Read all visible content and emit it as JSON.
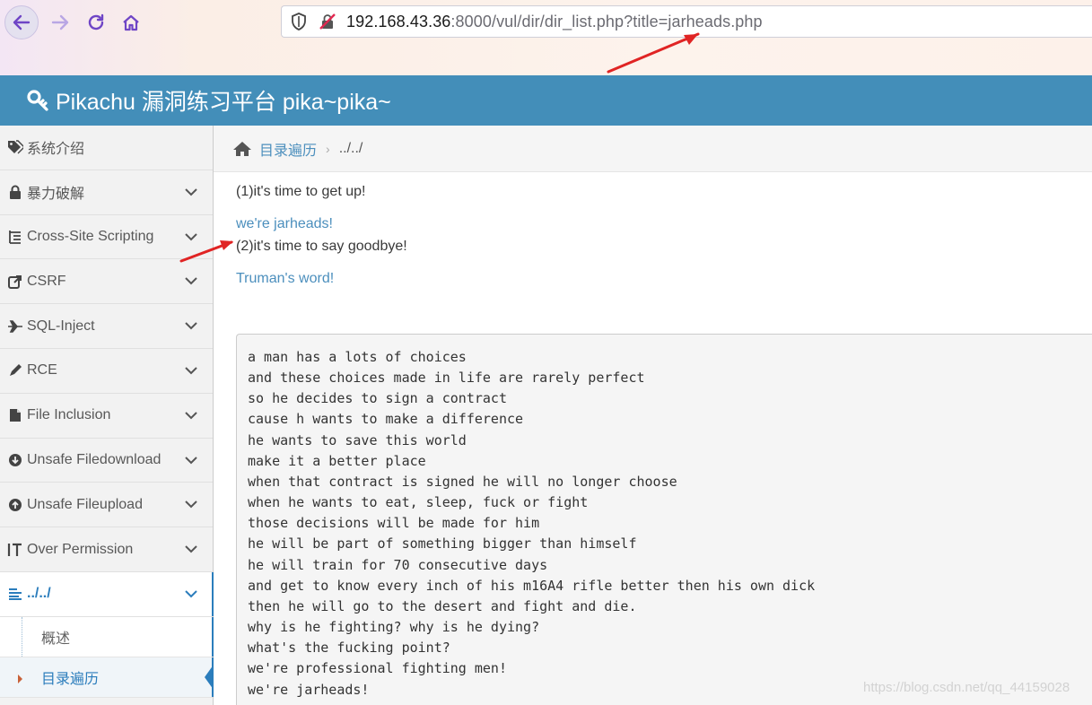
{
  "browser": {
    "url_host": "192.168.43.36",
    "url_rest": ":8000/vul/dir/dir_list.php?title=jarheads.php"
  },
  "header": {
    "title": "Pikachu 漏洞练习平台 pika~pika~"
  },
  "sidebar": {
    "items": [
      {
        "label": "系统介绍",
        "icon": "tags-icon",
        "expandable": false
      },
      {
        "label": "暴力破解",
        "icon": "lock-icon",
        "expandable": true
      },
      {
        "label": "Cross-Site Scripting",
        "icon": "list-tree-icon",
        "expandable": true
      },
      {
        "label": "CSRF",
        "icon": "share-icon",
        "expandable": true
      },
      {
        "label": "SQL-Inject",
        "icon": "plane-icon",
        "expandable": true
      },
      {
        "label": "RCE",
        "icon": "pencil-icon",
        "expandable": true
      },
      {
        "label": "File Inclusion",
        "icon": "file-icon",
        "expandable": true
      },
      {
        "label": "Unsafe Filedownload",
        "icon": "download-circle-icon",
        "expandable": true
      },
      {
        "label": "Unsafe Fileupload",
        "icon": "upload-circle-icon",
        "expandable": true
      },
      {
        "label": "Over Permission",
        "icon": "text-height-icon",
        "expandable": true
      },
      {
        "label": "../../",
        "icon": "align-left-icon",
        "expandable": true
      }
    ],
    "subitems": [
      {
        "label": "概述"
      },
      {
        "label": "目录遍历"
      }
    ]
  },
  "breadcrumb": {
    "home_link": "目录遍历",
    "current": "../../"
  },
  "content": {
    "line1": "(1)it's time to get up!",
    "link1": "we're jarheads!",
    "line2": "(2)it's time to say goodbye!",
    "link2": "Truman's word!"
  },
  "poem": [
    "a man has a lots of choices",
    "and these choices made in life are rarely perfect",
    "so he decides to sign a contract",
    "cause h wants to make a difference",
    "he wants to save this world",
    "make it a better place",
    "when that contract is signed he will no longer choose",
    "when he wants to eat, sleep, fuck or fight",
    "those decisions will be made for him",
    "he will be part of something bigger than himself",
    "he will train for 70 consecutive days",
    "and get to know every inch of his m16A4 rifle better then his own dick",
    "then he will go to the desert and fight and die.",
    "why is he fighting? why is he dying?",
    "what's the fucking point?",
    "we're professional fighting men!",
    "we're jarheads!"
  ],
  "watermark": "https://blog.csdn.net/qq_44159028",
  "colors": {
    "header": "#438eb9",
    "link": "#4c8fbd",
    "accent": "#2b7dbc",
    "annotation_arrow": "#e02424"
  }
}
